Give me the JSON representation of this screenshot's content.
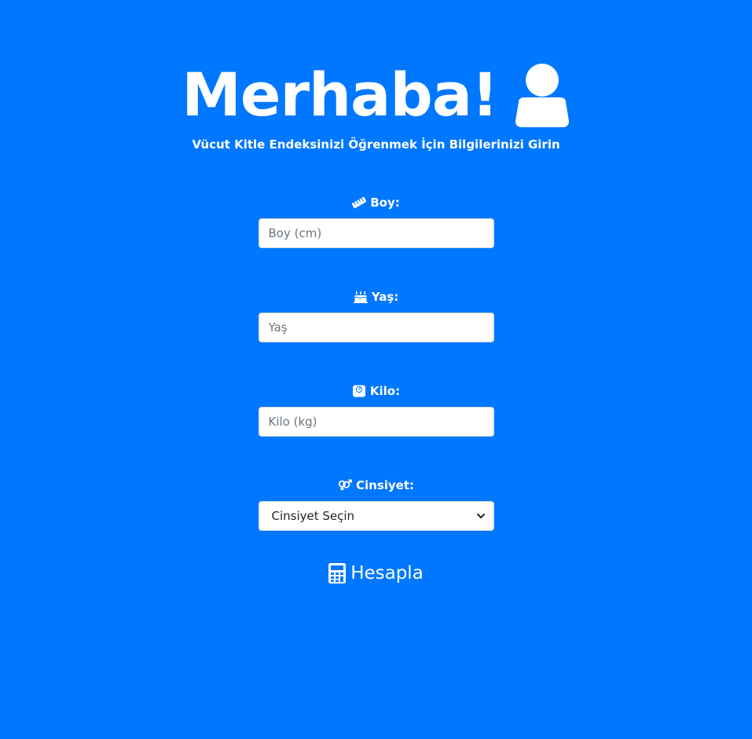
{
  "header": {
    "title": "Merhaba!",
    "subtitle": "Vücut Kitle Endeksinizi Öğrenmek İçin Bilgilerinizi Girin",
    "icon": "user-icon"
  },
  "form": {
    "height": {
      "label": "Boy:",
      "icon": "ruler-icon",
      "placeholder": "Boy (cm)"
    },
    "age": {
      "label": "Yaş:",
      "icon": "birthday-cake-icon",
      "placeholder": "Yaş"
    },
    "weight": {
      "label": "Kilo:",
      "icon": "weight-scale-icon",
      "placeholder": "Kilo (kg)"
    },
    "gender": {
      "label": "Cinsiyet:",
      "icon": "venus-mars-icon",
      "selected": "Cinsiyet Seçin"
    },
    "submit": {
      "label": "Hesapla",
      "icon": "calculator-icon"
    }
  },
  "colors": {
    "background": "#0077ff",
    "text": "#ffffff"
  }
}
